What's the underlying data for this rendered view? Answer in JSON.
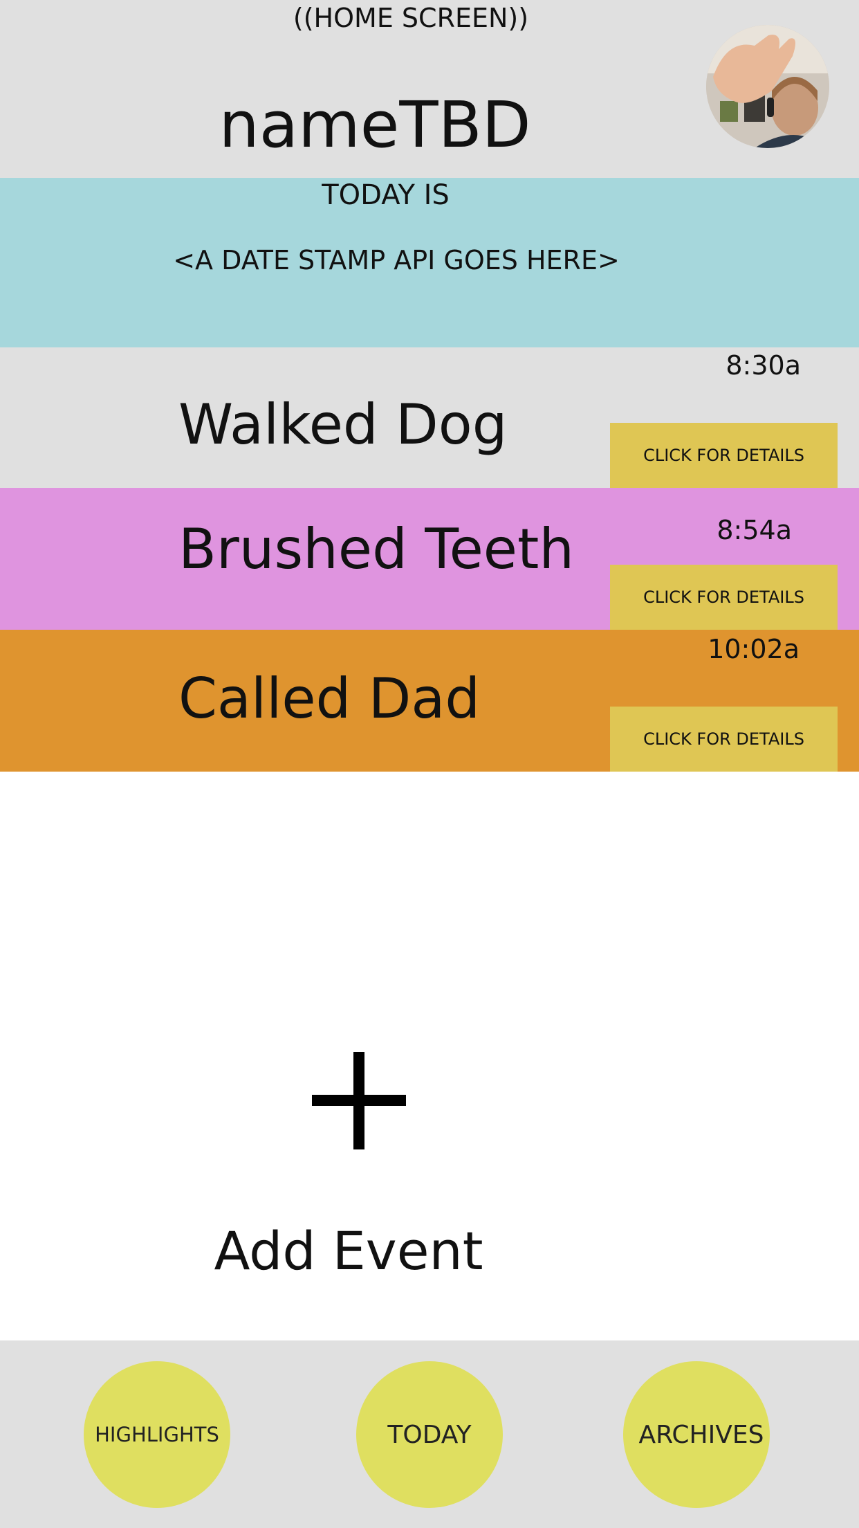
{
  "header": {
    "screen_label": "((HOME SCREEN))",
    "app_title": "nameTBD"
  },
  "date_banner": {
    "today_label": "TODAY IS",
    "date_stamp": "<A DATE STAMP API GOES HERE>"
  },
  "events": [
    {
      "name": "Walked Dog",
      "time": "8:30a",
      "details_label": "CLICK FOR DETAILS",
      "color": "#e0e0e0"
    },
    {
      "name": "Brushed Teeth",
      "time": "8:54a",
      "details_label": "CLICK FOR DETAILS",
      "color": "#df94df"
    },
    {
      "name": "Called Dad",
      "time": "10:02a",
      "details_label": "CLICK FOR DETAILS",
      "color": "#df942f"
    }
  ],
  "add_event": {
    "label": "Add Event",
    "icon": "plus-icon"
  },
  "bottom_nav": {
    "items": [
      {
        "label": "HIGHLIGHTS"
      },
      {
        "label": "TODAY"
      },
      {
        "label": "ARCHIVES"
      }
    ]
  },
  "colors": {
    "header_bg": "#e0e0e0",
    "banner_bg": "#a6d7dc",
    "details_button": "#dfc654",
    "nav_button": "#dfdf60"
  }
}
